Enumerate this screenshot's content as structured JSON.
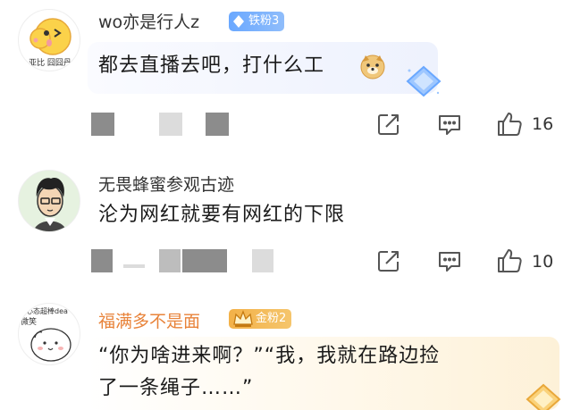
{
  "comments": [
    {
      "username": "wo亦是行人z",
      "badge": "铁粉3",
      "text": "都去直播去吧，打什么工",
      "likes": "16",
      "avatar_text": "亚比 囧囧丹",
      "emoji": "doge-emoji",
      "colors": {
        "username": "#333333",
        "badge": "#6aa8ff"
      }
    },
    {
      "username": "无畏蜂蜜参观古迹",
      "text": "沦为网红就要有网红的下限",
      "likes": "10"
    },
    {
      "username": "福满多不是面",
      "badge": "金粉2",
      "text_line1": "“你为啥进来啊？”“我，我就在路边捡",
      "text_line2": "了一条绳子……”",
      "avatar_text_1": "心态超棒dea",
      "avatar_text_2": "微笑",
      "colors": {
        "username": "#e8833a",
        "badge": "#f3b148"
      }
    }
  ],
  "icons": [
    "share-icon",
    "comment-icon",
    "like-icon"
  ]
}
